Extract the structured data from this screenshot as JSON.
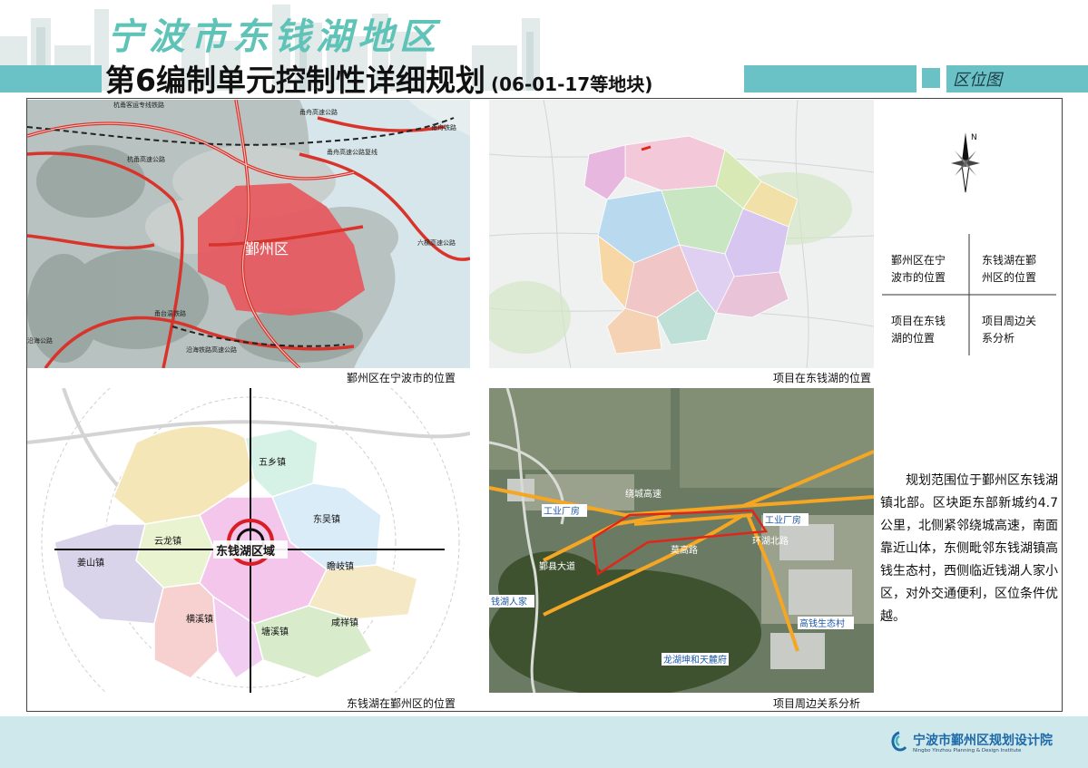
{
  "header": {
    "title_line1": "宁波市东钱湖地区",
    "title_line2": "第6编制单元控制性详细规划",
    "title_line2_sub": "(06-01-17等地块)",
    "section_label": "区位图"
  },
  "panels": {
    "top_left": {
      "caption": "鄞州区在宁波市的位置",
      "district_label": "鄞州区",
      "road_labels": [
        "杭甬客运专线铁路",
        "甬舟高速公路",
        "甬舟高速公路复线",
        "杭甬高速公路",
        "甬舟铁路",
        "甬台温铁路",
        "六横高速公路",
        "沿海铁路高速公路",
        "沿海公路"
      ]
    },
    "top_right": {
      "caption": "项目在东钱湖的位置"
    },
    "bottom_left": {
      "caption": "东钱湖在鄞州区的位置",
      "center_label": "东钱湖区域",
      "towns": [
        "五乡镇",
        "东吴镇",
        "云龙镇",
        "姜山镇",
        "瞻岐镇",
        "横溪镇",
        "塘溪镇",
        "咸祥镇"
      ]
    },
    "bottom_right": {
      "caption": "项目周边关系分析",
      "labels": [
        "绕城高速",
        "工业厂房",
        "工业厂房",
        "鄞县大道",
        "莫高路",
        "环湖北路",
        "钱湖人家",
        "高钱生态村",
        "龙湖坤和天麓府"
      ]
    }
  },
  "legend_grid": {
    "cells": [
      "鄞州区在宁\n波市的位置",
      "东钱湖在鄞\n州区的位置",
      "项目在东钱\n湖的位置",
      "项目周边关\n系分析"
    ]
  },
  "compass": {
    "north_label": "N"
  },
  "description": "规划范围位于鄞州区东钱湖镇北部。区块距东部新城约4.7公里，北侧紧邻绕城高速，南面靠近山体，东侧毗邻东钱湖镇高钱生态村，西侧临近钱湖人家小区，对外交通便利，区位条件优越。",
  "footer": {
    "org_name": "宁波市鄞州区规划设计院",
    "org_name_en": "Ningbo Yinzhou Planning & Design Institute"
  },
  "colors": {
    "accent_teal": "#6ac2c6",
    "title_teal": "#5fc3b8",
    "footer_bg": "#cfe8ec",
    "road_red": "#d9342b",
    "road_orange": "#f5a623",
    "district_fill": "#e8565c"
  }
}
